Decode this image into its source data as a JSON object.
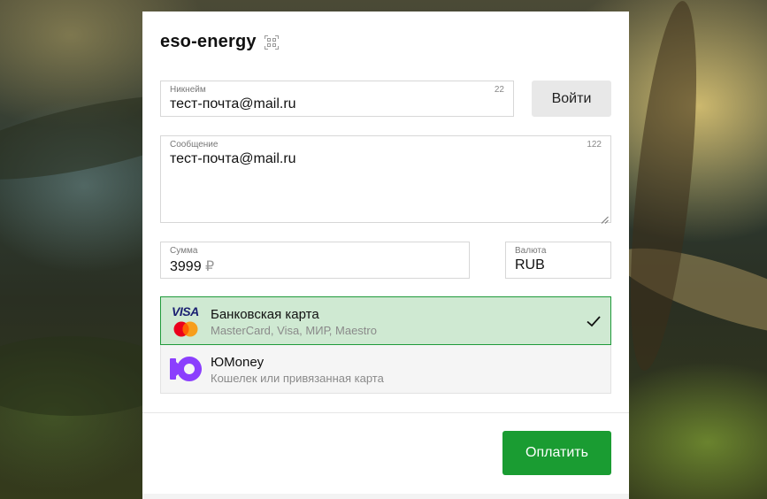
{
  "brand": {
    "name": "eso-energy",
    "qr_icon": "qr-code-icon"
  },
  "nickname": {
    "label": "Никнейм",
    "value": "тест-почта@mail.ru",
    "counter": "22"
  },
  "login_button": "Войти",
  "message": {
    "label": "Сообщение",
    "value": "тест-почта@mail.ru",
    "counter": "122"
  },
  "amount": {
    "label": "Сумма",
    "value": "3999",
    "currency_symbol": "₽"
  },
  "currency": {
    "label": "Валюта",
    "value": "RUB"
  },
  "payment_methods": [
    {
      "title": "Банковская карта",
      "subtitle": "MasterCard, Visa, МИР, Maestro",
      "logo_text": "VISA",
      "icons": [
        "visa-icon",
        "mastercard-icon"
      ],
      "selected": true
    },
    {
      "title": "ЮMoney",
      "subtitle": "Кошелек или привязанная карта",
      "icons": [
        "yoomoney-icon"
      ],
      "selected": false
    }
  ],
  "pay_button": "Оплатить",
  "colors": {
    "accent_green": "#1a9c32",
    "selected_bg": "#cfe9d2",
    "visa_blue": "#1a1f71",
    "yoomoney_purple": "#8b3ffd"
  }
}
